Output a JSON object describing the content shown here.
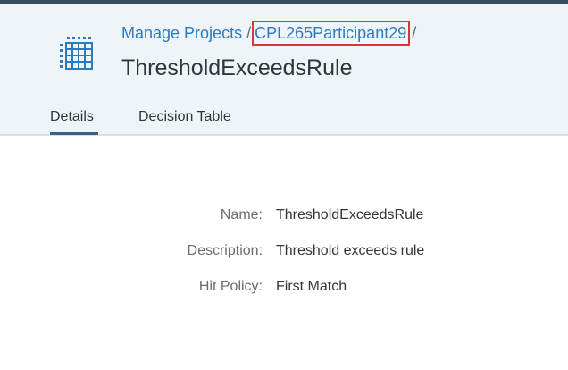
{
  "breadcrumb": {
    "items": [
      "Manage Projects",
      "CPL265Participant29"
    ],
    "separator": "/"
  },
  "header": {
    "title": "ThresholdExceedsRule",
    "icon": "decision-table-icon"
  },
  "tabs": [
    {
      "label": "Details",
      "selected": true
    },
    {
      "label": "Decision Table",
      "selected": false
    }
  ],
  "details": {
    "fields": [
      {
        "label": "Name:",
        "value": "ThresholdExceedsRule"
      },
      {
        "label": "Description:",
        "value": "Threshold exceeds rule"
      },
      {
        "label": "Hit Policy:",
        "value": "First Match"
      }
    ]
  },
  "colors": {
    "link": "#2b7bbf",
    "highlight_box": "#e0303d",
    "header_bg": "#eff4f9",
    "tab_underline": "#346187",
    "icon": "#2b7bbf"
  }
}
